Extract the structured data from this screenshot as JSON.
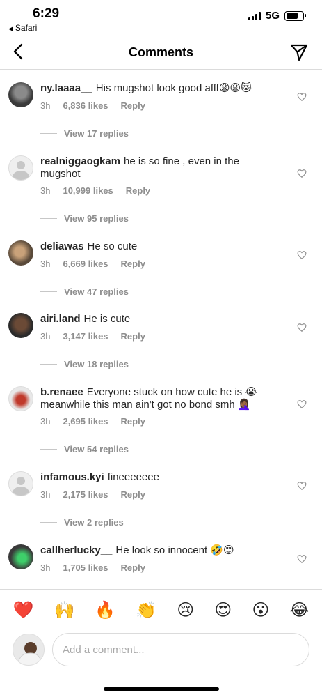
{
  "status_bar": {
    "time": "6:29",
    "back_app": "Safari",
    "network": "5G",
    "signal_bars": 4,
    "battery_level": 0.7
  },
  "header": {
    "title": "Comments",
    "back_icon": "chevron-left-icon",
    "send_icon": "paper-plane-icon"
  },
  "comments": [
    {
      "user": "ny.laaaa__",
      "text": "His mugshot look good afff😩😩😻",
      "time": "3h",
      "likes": "6,836 likes",
      "reply": "Reply",
      "view_replies": "View 17 replies",
      "avatar": "photo"
    },
    {
      "user": "realniggaogkam",
      "text": "he is so fine , even in the mugshot",
      "time": "3h",
      "likes": "10,999 likes",
      "reply": "Reply",
      "view_replies": "View 95 replies",
      "avatar": "default"
    },
    {
      "user": "deliawas",
      "text": "He so cute",
      "time": "3h",
      "likes": "6,669 likes",
      "reply": "Reply",
      "view_replies": "View 47 replies",
      "avatar": "photo"
    },
    {
      "user": "airi.land",
      "text": "He is cute",
      "time": "3h",
      "likes": "3,147 likes",
      "reply": "Reply",
      "view_replies": "View 18 replies",
      "avatar": "photo"
    },
    {
      "user": "b.renaee",
      "text": "Everyone stuck on how cute he is 😭 meanwhile this man ain't got no bond smh 🤦🏾‍♀️",
      "time": "3h",
      "likes": "2,695 likes",
      "reply": "Reply",
      "view_replies": "View 54 replies",
      "avatar": "photo"
    },
    {
      "user": "infamous.kyi",
      "text": "fineeeeeee",
      "time": "3h",
      "likes": "2,175 likes",
      "reply": "Reply",
      "view_replies": "View 2 replies",
      "avatar": "default"
    },
    {
      "user": "callherlucky__",
      "text": "He look so innocent 🤣😍",
      "time": "3h",
      "likes": "1,705 likes",
      "reply": "Reply",
      "avatar": "photo"
    }
  ],
  "emoji_bar": [
    "❤️",
    "🙌",
    "🔥",
    "👏",
    "😢",
    "😍",
    "😮",
    "😂"
  ],
  "comment_input": {
    "placeholder": "Add a comment..."
  },
  "colors": {
    "text": "#262626",
    "secondary": "#8e8e8e",
    "divider": "#dbdbdb",
    "background": "#ffffff"
  }
}
